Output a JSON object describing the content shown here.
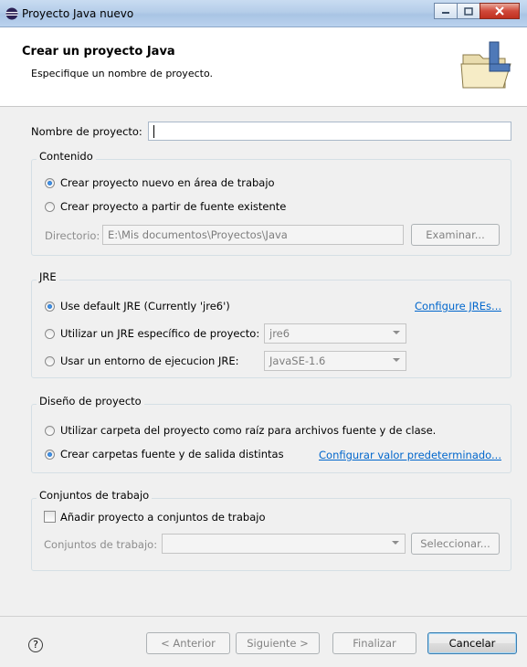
{
  "window": {
    "title": "Proyecto Java nuevo"
  },
  "header": {
    "title": "Crear un proyecto Java",
    "subtitle": "Especifique un nombre de proyecto."
  },
  "project_name": {
    "label": "Nombre de proyecto:",
    "value": ""
  },
  "contents": {
    "title": "Contenido",
    "option_new": "Crear proyecto nuevo en área de trabajo",
    "option_existing": "Crear proyecto a partir de fuente existente",
    "directory_label": "Directorio:",
    "directory_value": "E:\\Mis documentos\\Proyectos\\Java",
    "browse_button": "Examinar..."
  },
  "jre": {
    "title": "JRE",
    "option_default": "Use default JRE (Currently 'jre6')",
    "configure_link": "Configure JREs...",
    "option_specific": "Utilizar un JRE específico de proyecto:",
    "specific_value": "jre6",
    "option_env": "Usar un entorno de ejecucion JRE:",
    "env_value": "JavaSE-1.6"
  },
  "layout": {
    "title": "Diseño de proyecto",
    "option_root": "Utilizar carpeta del proyecto como raíz para archivos fuente y de clase.",
    "option_separate": "Crear carpetas fuente y de salida distintas",
    "configure_link": "Configurar valor predeterminado..."
  },
  "working_sets": {
    "title": "Conjuntos de trabajo",
    "checkbox_label": "Añadir proyecto a conjuntos de trabajo",
    "sets_label": "Conjuntos de trabajo:",
    "select_button": "Seleccionar..."
  },
  "footer": {
    "help_symbol": "?",
    "back_button": "< Anterior",
    "next_button": "Siguiente >",
    "finish_button": "Finalizar",
    "cancel_button": "Cancelar"
  }
}
